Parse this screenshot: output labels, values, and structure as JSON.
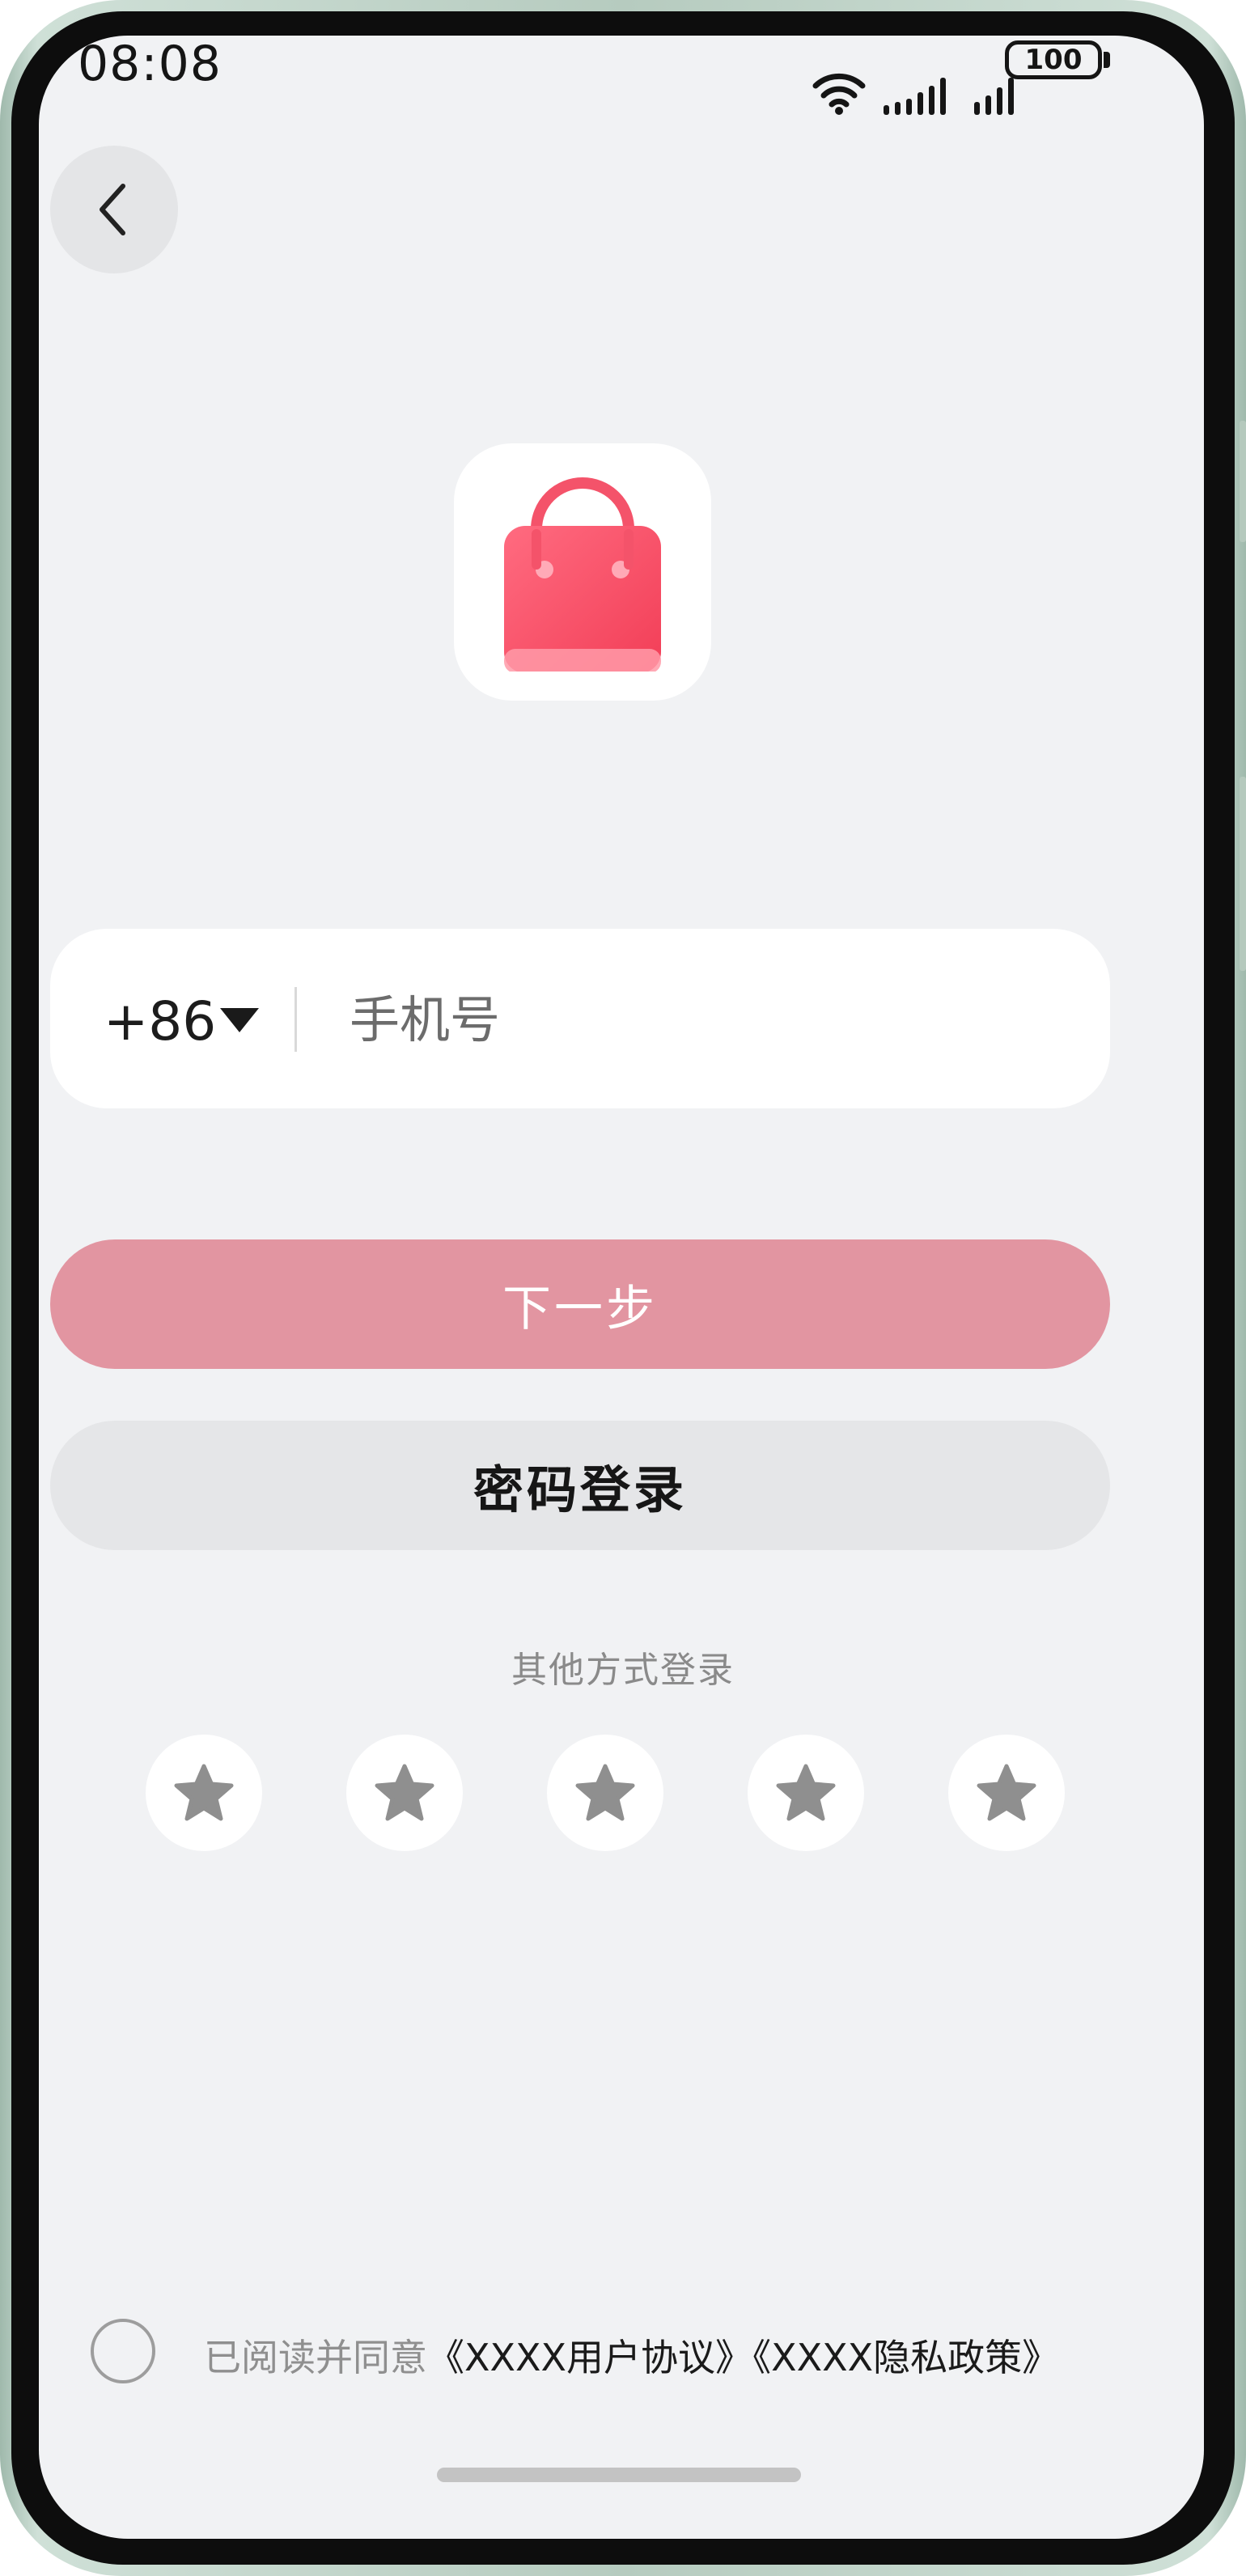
{
  "status_bar": {
    "time": "08:08",
    "battery": "100"
  },
  "nav": {
    "back_icon": "chevron-left-icon"
  },
  "app": {
    "icon": "shopping-bag-icon",
    "accent_color": "#f4536a"
  },
  "phone_form": {
    "country_code": "+86",
    "phone_placeholder": "手机号",
    "phone_value": ""
  },
  "buttons": {
    "next_label": "下一步",
    "password_login_label": "密码登录"
  },
  "other_login": {
    "label": "其他方式登录",
    "icons": [
      "star-icon",
      "star-icon",
      "star-icon",
      "star-icon",
      "star-icon"
    ]
  },
  "agreement": {
    "checked": false,
    "prefix": "已阅读并同意",
    "user_agreement": "《XXXX用户协议》",
    "privacy_policy": "《XXXX隐私政策》"
  }
}
